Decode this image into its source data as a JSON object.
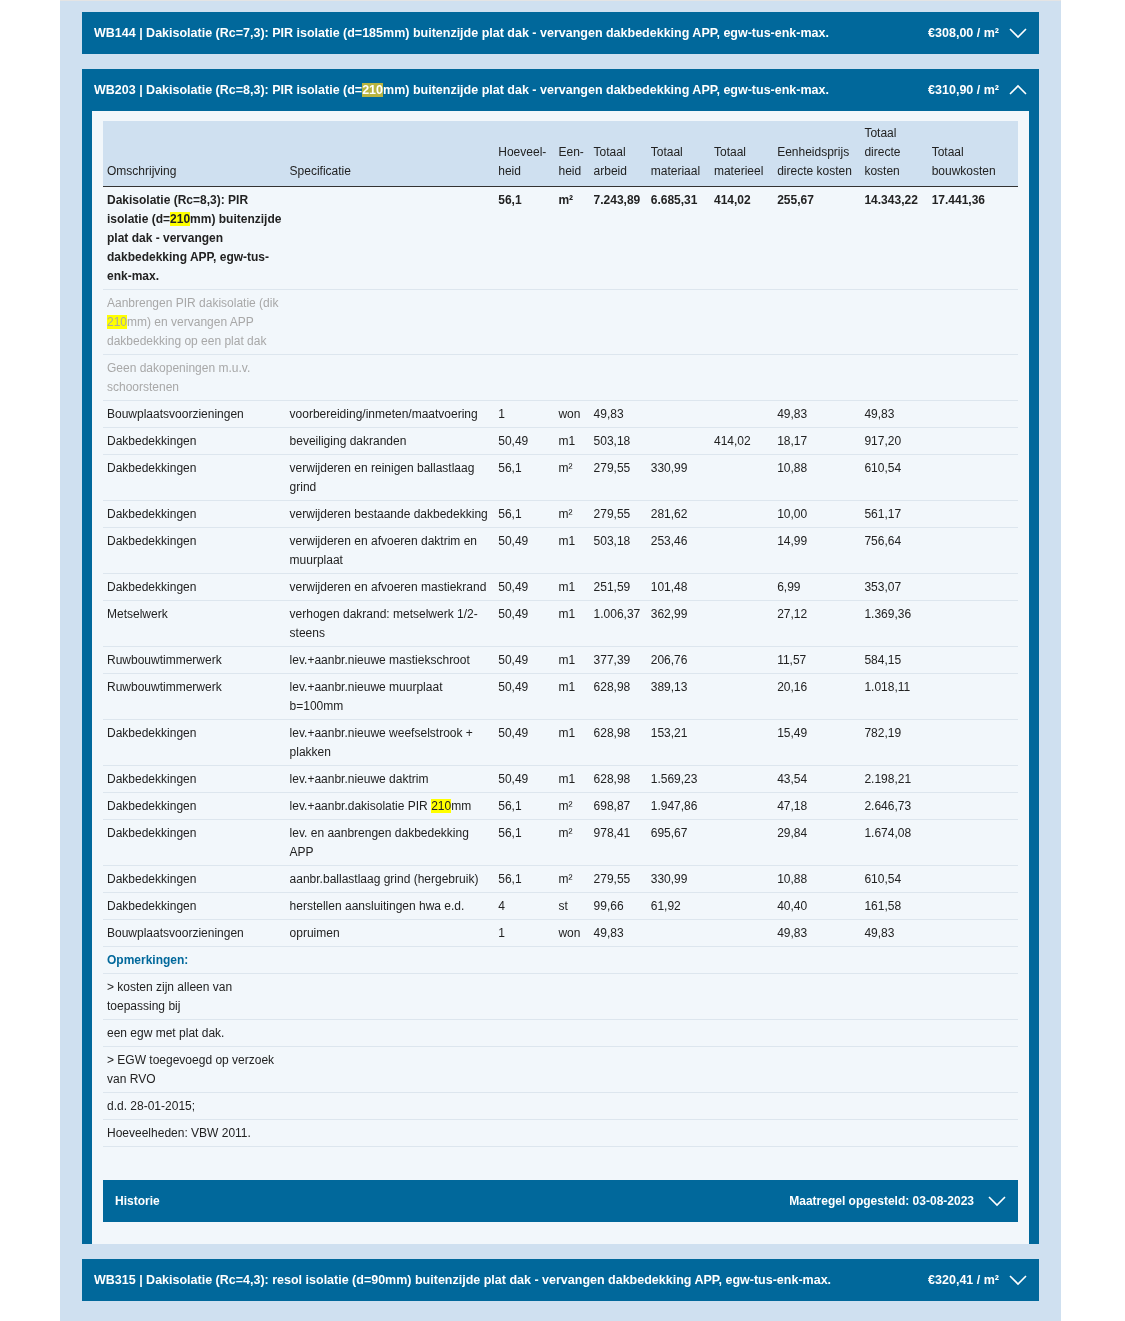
{
  "panels": [
    {
      "title": "WB144 | Dakisolatie (Rc=7,3): PIR isolatie (d=185mm) buitenzijde plat dak - vervangen dakbedekking APP, egw-tus-enk-max.",
      "price": "€308,00 / m²",
      "expanded": false
    },
    {
      "title": [
        {
          "text": "WB203 | Dakisolatie (Rc=8,3): PIR isolatie (d="
        },
        {
          "text": "210",
          "color": "#b8b440"
        },
        {
          "text": "mm) buitenzijde plat dak - vervangen dakbedekking APP, egw-tus-enk-max."
        }
      ],
      "price": "€310,90 / m²",
      "expanded": true,
      "table": {
        "columns": [
          "Omschrijving",
          "Specificatie",
          "Hoeveel-heid",
          "Een-heid",
          "Totaal arbeid",
          "Totaal materiaal",
          "Totaal materieel",
          "Eenheidsprijs directe kosten",
          "Totaal directe kosten",
          "Totaal bouwkosten"
        ],
        "rows": [
          {
            "kind": "total",
            "cells": [
              [
                {
                  "text": "Dakisolatie (Rc=8,3): PIR isolatie (d="
                },
                {
                  "text": "210",
                  "color": "#ffff00"
                },
                {
                  "text": "mm) buitenzijde plat dak - vervangen dakbedekking APP, egw-tus-enk-max."
                }
              ],
              null,
              "56,1",
              "m²",
              "7.243,89",
              "6.685,31",
              "414,02",
              "255,67",
              "14.343,22",
              "17.441,36"
            ]
          },
          {
            "kind": "note",
            "text": [
              {
                "text": "Aanbrengen PIR dakisolatie (dik "
              },
              {
                "text": "210",
                "color": "#ffff00"
              },
              {
                "text": "mm) en vervangen APP dakbedekking op een plat dak"
              }
            ]
          },
          {
            "kind": "note",
            "text": "Geen dakopeningen m.u.v. schoorstenen"
          },
          {
            "kind": "item",
            "cells": [
              "Bouwplaatsvoorzieningen",
              "voorbereiding/inmeten/maatvoering",
              "1",
              "won",
              "49,83",
              null,
              null,
              "49,83",
              "49,83",
              null
            ]
          },
          {
            "kind": "item",
            "cells": [
              "Dakbedekkingen",
              "beveiliging dakranden",
              "50,49",
              "m1",
              "503,18",
              null,
              "414,02",
              "18,17",
              "917,20",
              null
            ]
          },
          {
            "kind": "item",
            "cells": [
              "Dakbedekkingen",
              "verwijderen en reinigen ballastlaag grind",
              "56,1",
              "m²",
              "279,55",
              "330,99",
              null,
              "10,88",
              "610,54",
              null
            ]
          },
          {
            "kind": "item",
            "cells": [
              "Dakbedekkingen",
              "verwijderen bestaande dakbedekking",
              "56,1",
              "m²",
              "279,55",
              "281,62",
              null,
              "10,00",
              "561,17",
              null
            ]
          },
          {
            "kind": "item",
            "cells": [
              "Dakbedekkingen",
              "verwijderen en afvoeren daktrim en muurplaat",
              "50,49",
              "m1",
              "503,18",
              "253,46",
              null,
              "14,99",
              "756,64",
              null
            ]
          },
          {
            "kind": "item",
            "cells": [
              "Dakbedekkingen",
              "verwijderen en afvoeren mastiekrand",
              "50,49",
              "m1",
              "251,59",
              "101,48",
              null,
              "6,99",
              "353,07",
              null
            ]
          },
          {
            "kind": "item",
            "cells": [
              "Metselwerk",
              "verhogen dakrand: metselwerk 1/2-steens",
              "50,49",
              "m1",
              "1.006,37",
              "362,99",
              null,
              "27,12",
              "1.369,36",
              null
            ]
          },
          {
            "kind": "item",
            "cells": [
              "Ruwbouwtimmerwerk",
              "lev.+aanbr.nieuwe mastiekschroot",
              "50,49",
              "m1",
              "377,39",
              "206,76",
              null,
              "11,57",
              "584,15",
              null
            ]
          },
          {
            "kind": "item",
            "cells": [
              "Ruwbouwtimmerwerk",
              "lev.+aanbr.nieuwe muurplaat b=100mm",
              "50,49",
              "m1",
              "628,98",
              "389,13",
              null,
              "20,16",
              "1.018,11",
              null
            ]
          },
          {
            "kind": "item",
            "cells": [
              "Dakbedekkingen",
              "lev.+aanbr.nieuwe weefselstrook + plakken",
              "50,49",
              "m1",
              "628,98",
              "153,21",
              null,
              "15,49",
              "782,19",
              null
            ]
          },
          {
            "kind": "item",
            "cells": [
              "Dakbedekkingen",
              "lev.+aanbr.nieuwe daktrim",
              "50,49",
              "m1",
              "628,98",
              "1.569,23",
              null,
              "43,54",
              "2.198,21",
              null
            ]
          },
          {
            "kind": "item",
            "cells": [
              "Dakbedekkingen",
              [
                {
                  "text": "lev.+aanbr.dakisolatie PIR "
                },
                {
                  "text": "210",
                  "color": "#ffff00"
                },
                {
                  "text": "mm"
                }
              ],
              "56,1",
              "m²",
              "698,87",
              "1.947,86",
              null,
              "47,18",
              "2.646,73",
              null
            ]
          },
          {
            "kind": "item",
            "cells": [
              "Dakbedekkingen",
              "lev. en aanbrengen dakbedekking APP",
              "56,1",
              "m²",
              "978,41",
              "695,67",
              null,
              "29,84",
              "1.674,08",
              null
            ]
          },
          {
            "kind": "item",
            "cells": [
              "Dakbedekkingen",
              "aanbr.ballastlaag grind (hergebruik)",
              "56,1",
              "m²",
              "279,55",
              "330,99",
              null,
              "10,88",
              "610,54",
              null
            ]
          },
          {
            "kind": "item",
            "cells": [
              "Dakbedekkingen",
              "herstellen aansluitingen hwa e.d.",
              "4",
              "st",
              "99,66",
              "61,92",
              null,
              "40,40",
              "161,58",
              null
            ]
          },
          {
            "kind": "item",
            "cells": [
              "Bouwplaatsvoorzieningen",
              "opruimen",
              "1",
              "won",
              "49,83",
              null,
              null,
              "49,83",
              "49,83",
              null
            ]
          },
          {
            "kind": "heading",
            "text": "Opmerkingen:"
          },
          {
            "kind": "remark",
            "text": "> kosten zijn alleen van toepassing bij"
          },
          {
            "kind": "remark",
            "text": "een egw met plat dak."
          },
          {
            "kind": "remark",
            "text": "> EGW toegevoegd op verzoek van RVO"
          },
          {
            "kind": "remark",
            "text": "d.d. 28-01-2015;"
          },
          {
            "kind": "remark",
            "text": "Hoeveelheden: VBW 2011."
          }
        ]
      },
      "history": {
        "label": "Historie",
        "date": "Maatregel opgesteld: 03-08-2023",
        "expanded": false
      }
    },
    {
      "title": "WB315 | Dakisolatie (Rc=4,3): resol isolatie (d=90mm) buitenzijde plat dak - vervangen dakbedekking APP, egw-tus-enk-max.",
      "price": "€320,41 / m²",
      "expanded": false
    }
  ]
}
